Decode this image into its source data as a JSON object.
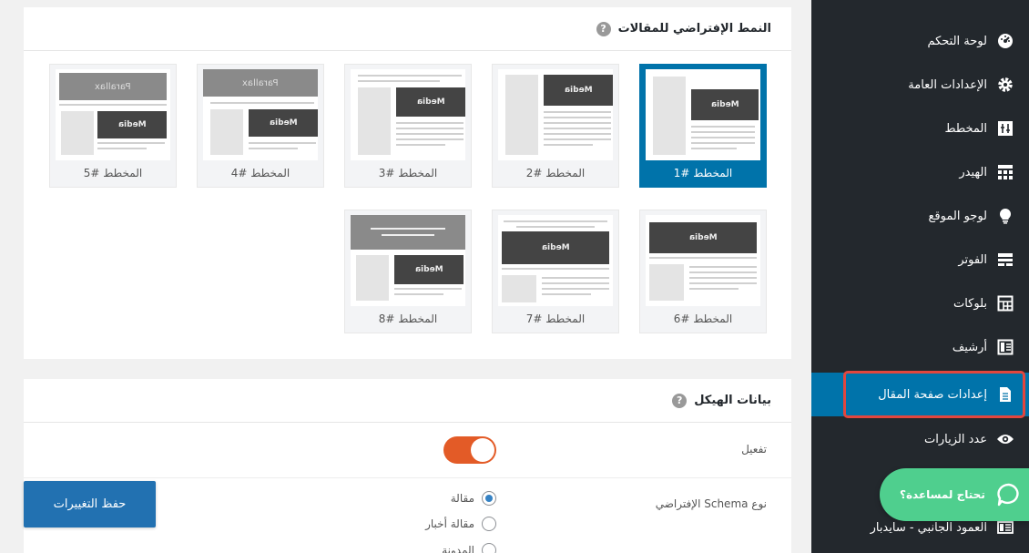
{
  "sidebar": {
    "items": [
      {
        "label": "لوحة التحكم",
        "icon": "dashboard-icon"
      },
      {
        "label": "الإعدادات العامة",
        "icon": "gear-icon"
      },
      {
        "label": "المخطط",
        "icon": "layout-icon"
      },
      {
        "label": "الهيدر",
        "icon": "header-icon"
      },
      {
        "label": "لوجو الموقع",
        "icon": "lightbulb-icon"
      },
      {
        "label": "الفوتر",
        "icon": "footer-icon"
      },
      {
        "label": "بلوكات",
        "icon": "blocks-icon"
      },
      {
        "label": "أرشيف",
        "icon": "archive-icon"
      },
      {
        "label": "إعدادات صفحة المقال",
        "icon": "document-icon",
        "active": true
      },
      {
        "label": "عدد الزيارات",
        "icon": "eye-icon"
      },
      {
        "label": "العمود الجانبي - سايدبار",
        "icon": "sidebar-icon"
      }
    ]
  },
  "help": {
    "label": "تحتاج لمساعدة؟"
  },
  "layouts_panel": {
    "title": "النمط الإفتراضي للمقالات",
    "help_icon": "?",
    "media_label": "Media",
    "parallax_label": "Parallax",
    "cards": [
      {
        "label": "المخطط #1",
        "selected": true
      },
      {
        "label": "المخطط #2"
      },
      {
        "label": "المخطط #3"
      },
      {
        "label": "المخطط #4"
      },
      {
        "label": "المخطط #5"
      },
      {
        "label": "المخطط #6"
      },
      {
        "label": "المخطط #7"
      },
      {
        "label": "المخطط #8"
      }
    ]
  },
  "schema_panel": {
    "title": "بيانات الهيكل",
    "help_icon": "?",
    "enable_label": "تفعيل",
    "enabled": true,
    "type_label": "نوع Schema الإفتراضي",
    "options": [
      {
        "label": "مقالة",
        "checked": true
      },
      {
        "label": "مقالة أخبار"
      },
      {
        "label": "المدونة"
      }
    ]
  },
  "save_button": {
    "label": "حفظ التغييرات"
  },
  "colors": {
    "sidebar": "#23282d",
    "active": "#0073aa",
    "toggle": "#e35b27",
    "help": "#4fcf8e",
    "highlight": "#e2463e"
  }
}
